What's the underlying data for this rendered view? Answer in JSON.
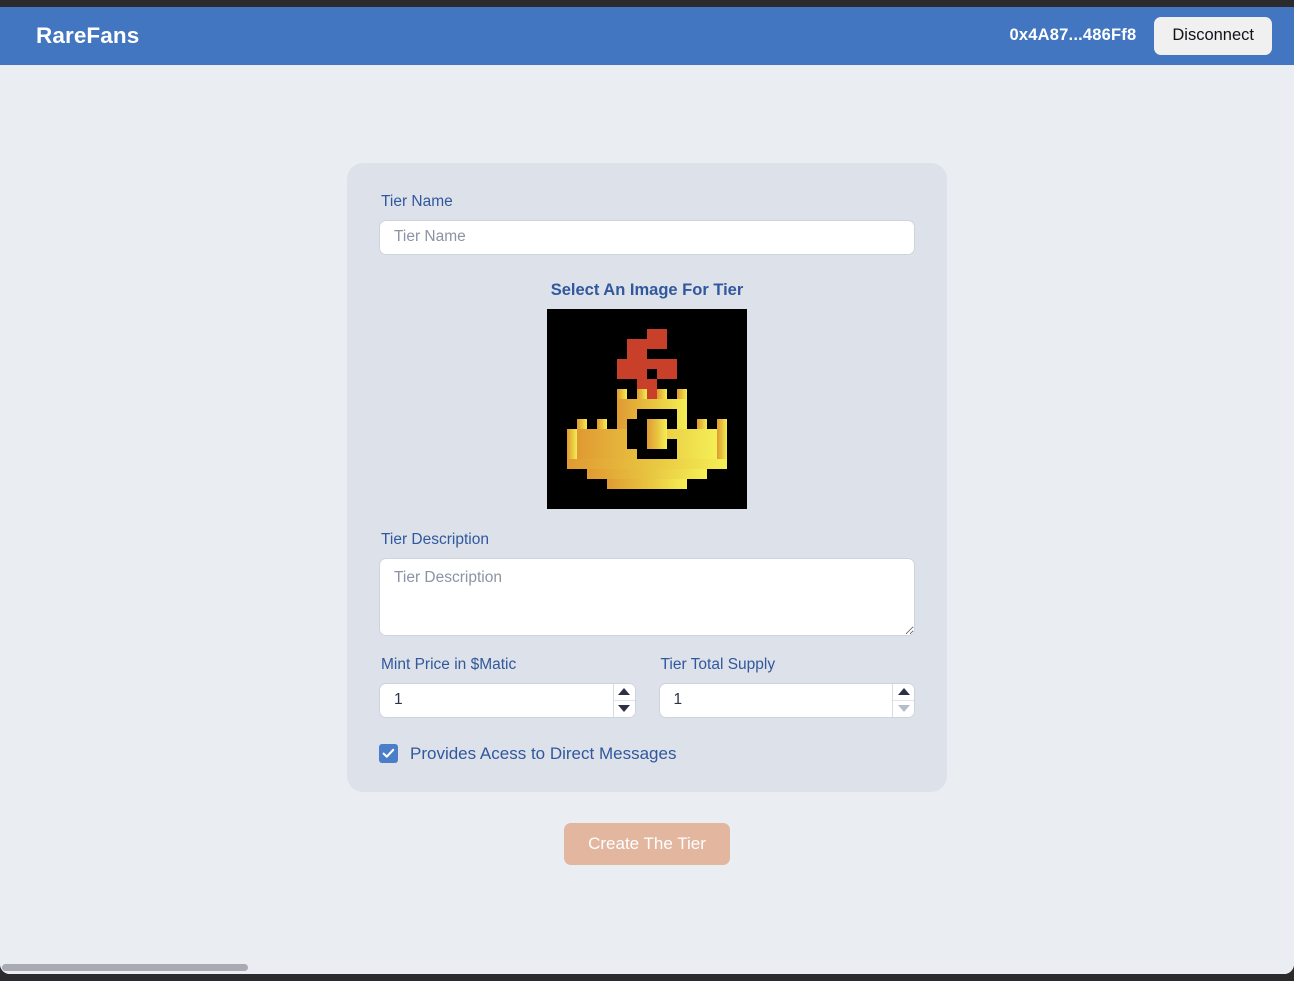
{
  "header": {
    "brand": "RareFans",
    "wallet_address": "0x4A87...486Ff8",
    "disconnect_label": "Disconnect",
    "background_color": "#4376c0"
  },
  "form": {
    "tier_name": {
      "label": "Tier Name",
      "placeholder": "Tier Name",
      "value": ""
    },
    "image_picker": {
      "label": "Select An Image For Tier",
      "icon_name": "pixel-crown-logo",
      "background_color": "#000000",
      "crown_gold_left": "#e8a33c",
      "crown_gold_right": "#f2e24f",
      "gem_color": "#c8402a"
    },
    "tier_description": {
      "label": "Tier Description",
      "placeholder": "Tier Description",
      "value": ""
    },
    "mint_price": {
      "label": "Mint Price in $Matic",
      "value": "1",
      "increment_enabled": true,
      "decrement_enabled": true
    },
    "tier_total_supply": {
      "label": "Tier Total Supply",
      "value": "1",
      "increment_enabled": true,
      "decrement_enabled": false
    },
    "dm_access": {
      "label": "Provides Acess to Direct Messages",
      "checked": true,
      "checkbox_color": "#4a7ec8"
    },
    "submit": {
      "label": "Create The Tier",
      "background_color": "#e2b69f",
      "disabled": true
    },
    "card_background": "#dde1ea",
    "label_color": "#31589c"
  },
  "page": {
    "background_color": "#eaeef2"
  }
}
